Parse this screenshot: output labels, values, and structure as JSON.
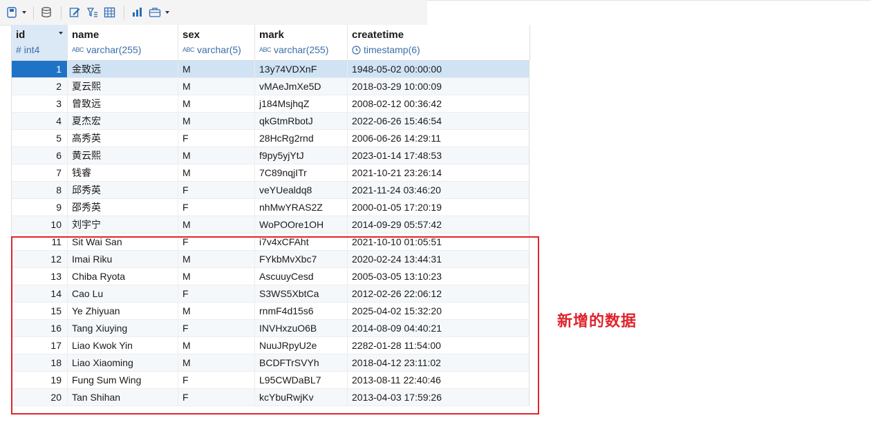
{
  "toolbar": {
    "icons": [
      "save-icon",
      "database-icon",
      "edit-icon",
      "filter-icon",
      "grid-icon",
      "chart-icon",
      "briefcase-icon"
    ]
  },
  "columns": [
    {
      "name": "id",
      "type": "int4",
      "type_icon": "#"
    },
    {
      "name": "name",
      "type": "varchar(255)",
      "type_icon": "ABC"
    },
    {
      "name": "sex",
      "type": "varchar(5)",
      "type_icon": "ABC"
    },
    {
      "name": "mark",
      "type": "varchar(255)",
      "type_icon": "ABC"
    },
    {
      "name": "createtime",
      "type": "timestamp(6)",
      "type_icon": "clock"
    }
  ],
  "rows": [
    [
      "1",
      "金致远",
      "M",
      "13y74VDXnF",
      "1948-05-02 00:00:00"
    ],
    [
      "2",
      "夏云熙",
      "M",
      "vMAeJmXe5D",
      "2018-03-29 10:00:09"
    ],
    [
      "3",
      "曾致远",
      "M",
      "j184MsjhqZ",
      "2008-02-12 00:36:42"
    ],
    [
      "4",
      "夏杰宏",
      "M",
      "qkGtmRbotJ",
      "2022-06-26 15:46:54"
    ],
    [
      "5",
      "高秀英",
      "F",
      "28HcRg2rnd",
      "2006-06-26 14:29:11"
    ],
    [
      "6",
      "黄云熙",
      "M",
      "f9py5yjYtJ",
      "2023-01-14 17:48:53"
    ],
    [
      "7",
      "钱睿",
      "M",
      "7C89nqjITr",
      "2021-10-21 23:26:14"
    ],
    [
      "8",
      "邱秀英",
      "F",
      "veYUealdq8",
      "2021-11-24 03:46:20"
    ],
    [
      "9",
      "邵秀英",
      "F",
      "nhMwYRAS2Z",
      "2000-01-05 17:20:19"
    ],
    [
      "10",
      "刘宇宁",
      "M",
      "WoPOOre1OH",
      "2014-09-29 05:57:42"
    ],
    [
      "11",
      "Sit Wai San",
      "F",
      "i7v4xCFAht",
      "2021-10-10 01:05:51"
    ],
    [
      "12",
      "Imai Riku",
      "M",
      "FYkbMvXbc7",
      "2020-02-24 13:44:31"
    ],
    [
      "13",
      "Chiba Ryota",
      "M",
      "AscuuyCesd",
      "2005-03-05 13:10:23"
    ],
    [
      "14",
      "Cao Lu",
      "F",
      "S3WS5XbtCa",
      "2012-02-26 22:06:12"
    ],
    [
      "15",
      "Ye Zhiyuan",
      "M",
      "rnmF4d15s6",
      "2025-04-02 15:32:20"
    ],
    [
      "16",
      "Tang Xiuying",
      "F",
      "INVHxzuO6B",
      "2014-08-09 04:40:21"
    ],
    [
      "17",
      "Liao Kwok Yin",
      "M",
      "NuuJRpyU2e",
      "2282-01-28 11:54:00"
    ],
    [
      "18",
      "Liao Xiaoming",
      "M",
      "BCDFTrSVYh",
      "2018-04-12 23:11:02"
    ],
    [
      "19",
      "Fung Sum Wing",
      "F",
      "L95CWDaBL7",
      "2013-08-11 22:40:46"
    ],
    [
      "20",
      "Tan Shihan",
      "F",
      "kcYbuRwjKv",
      "2013-04-03 17:59:26"
    ]
  ],
  "selected_row": "1",
  "annotation": {
    "text": "新增的数据",
    "color": "#e0232b"
  }
}
